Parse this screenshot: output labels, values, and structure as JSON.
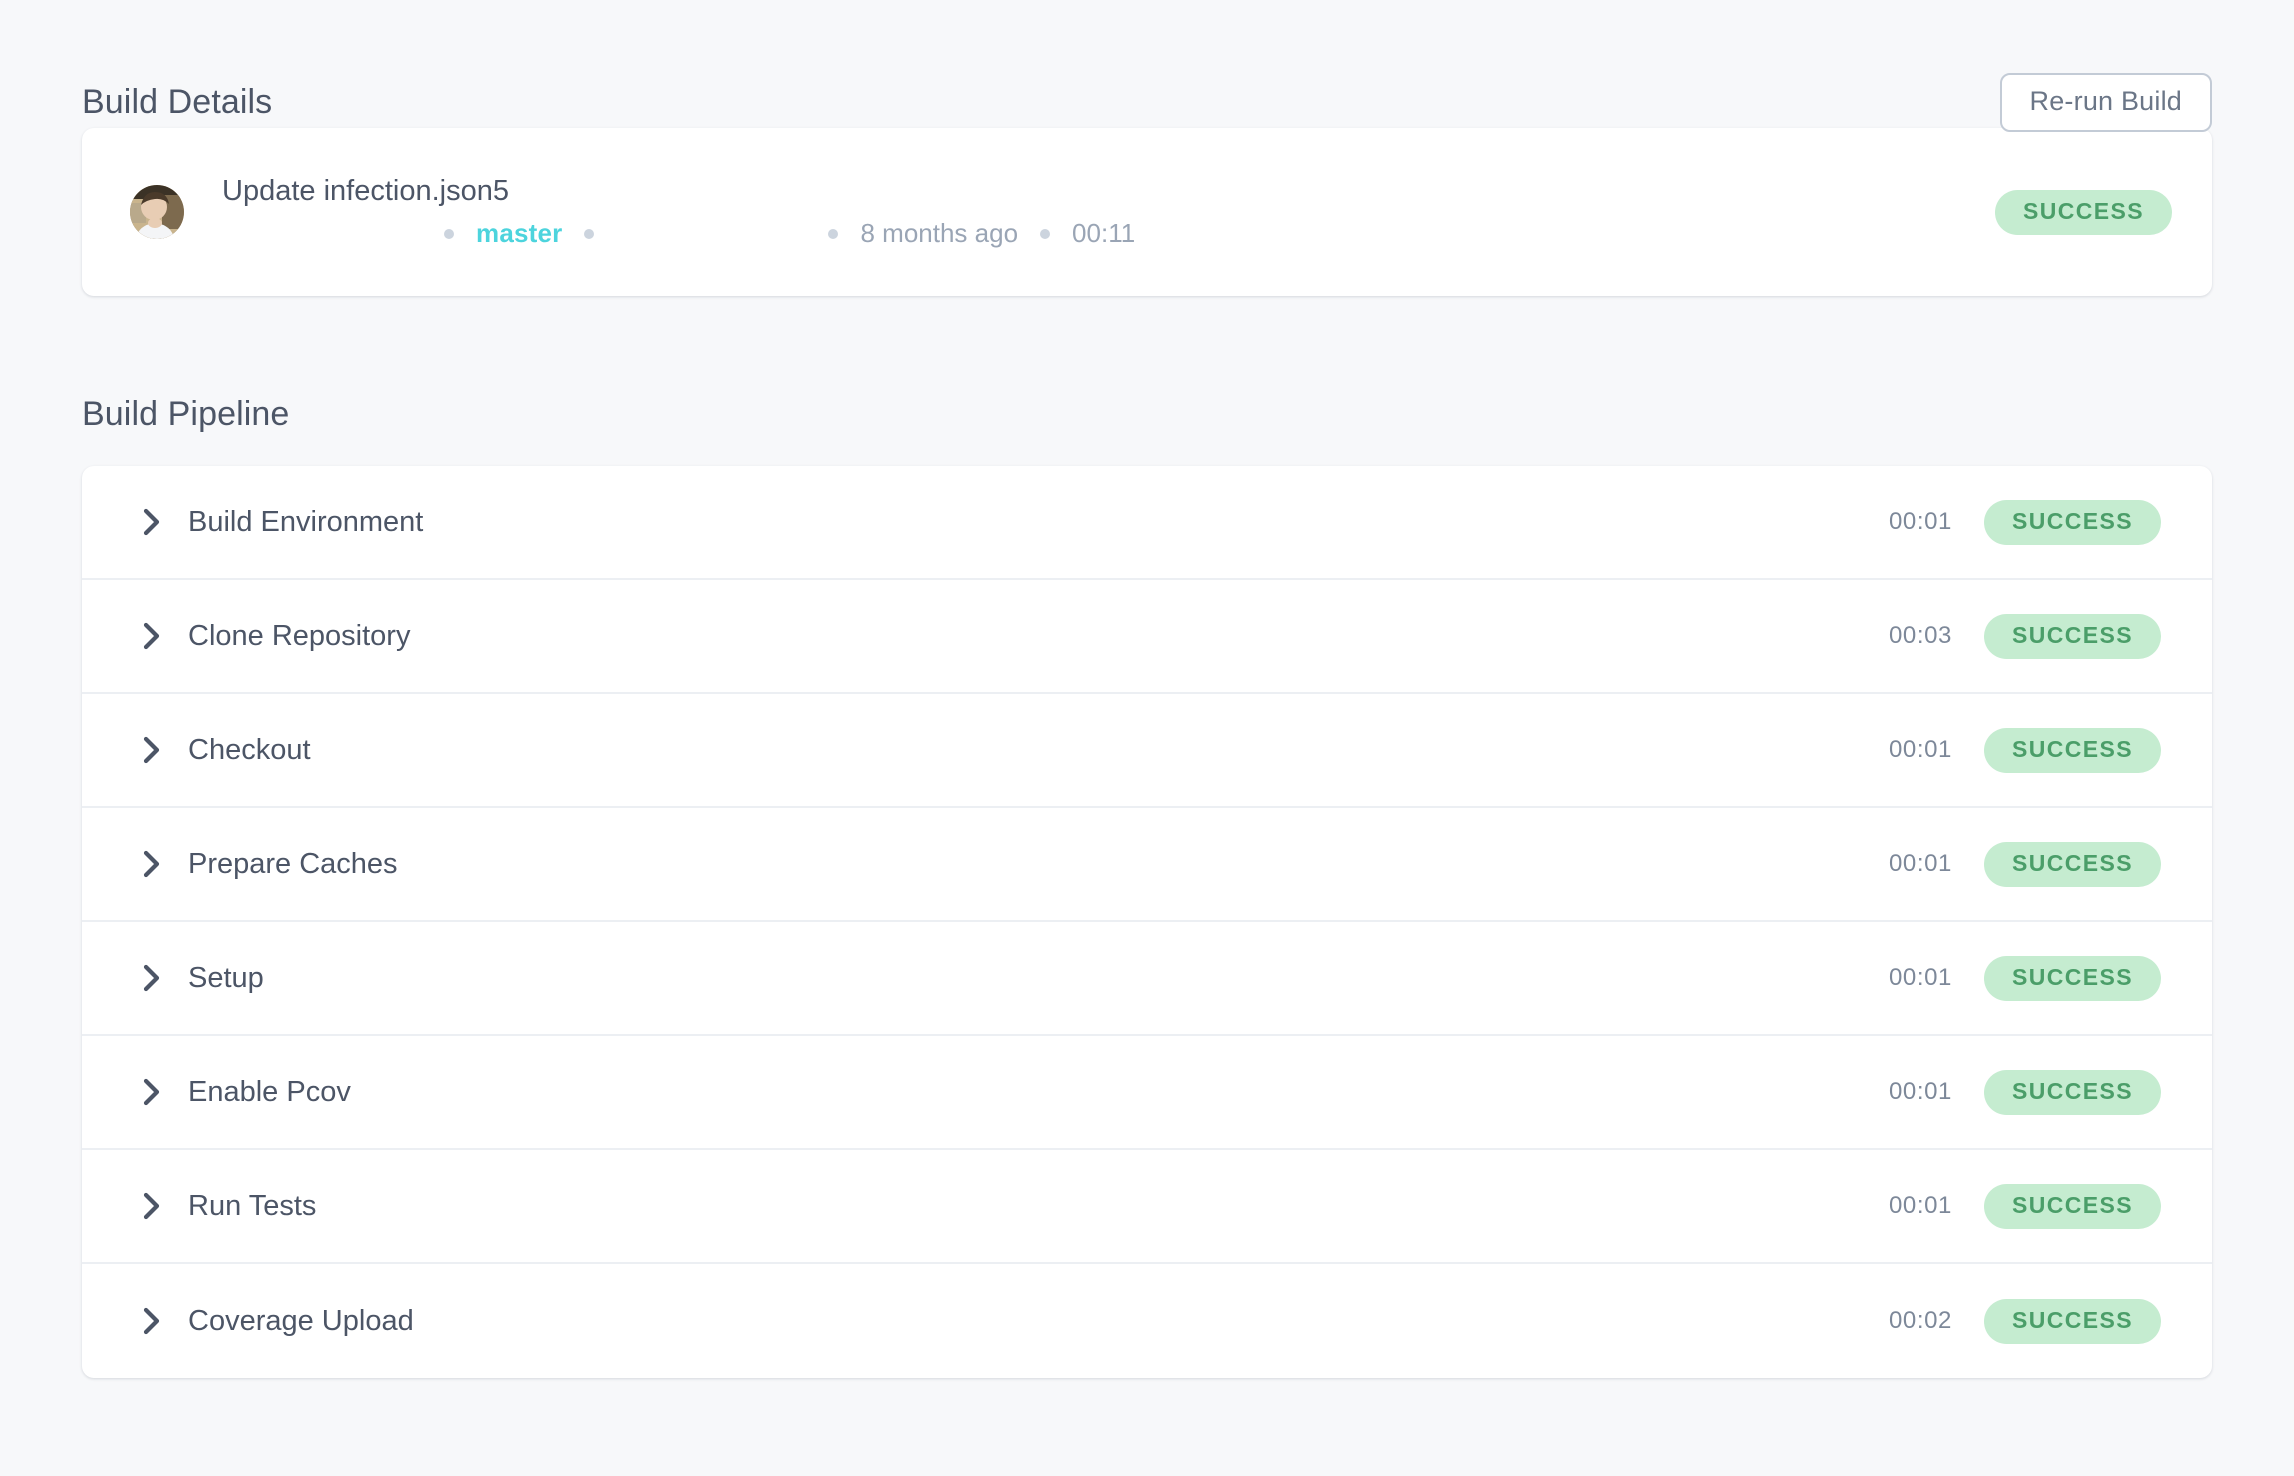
{
  "build_details": {
    "section_title": "Build Details",
    "rerun_label": "Re-run Build",
    "commit_message": "Update infection.json5",
    "author": "",
    "branch": "master",
    "commit_hash": "",
    "relative_time": "8 months ago",
    "duration": "00:11",
    "status": "SUCCESS",
    "avatar_name": "user-avatar"
  },
  "build_pipeline": {
    "section_title": "Build Pipeline",
    "stages": [
      {
        "name": "Build Environment",
        "duration": "00:01",
        "status": "SUCCESS"
      },
      {
        "name": "Clone Repository",
        "duration": "00:03",
        "status": "SUCCESS"
      },
      {
        "name": "Checkout",
        "duration": "00:01",
        "status": "SUCCESS"
      },
      {
        "name": "Prepare Caches",
        "duration": "00:01",
        "status": "SUCCESS"
      },
      {
        "name": "Setup",
        "duration": "00:01",
        "status": "SUCCESS"
      },
      {
        "name": "Enable Pcov",
        "duration": "00:01",
        "status": "SUCCESS"
      },
      {
        "name": "Run Tests",
        "duration": "00:01",
        "status": "SUCCESS"
      },
      {
        "name": "Coverage Upload",
        "duration": "00:02",
        "status": "SUCCESS"
      }
    ]
  },
  "icons": {
    "chevron_right": "chevron-right-icon"
  },
  "colors": {
    "page_background": "#f7f8fa",
    "card_background": "#ffffff",
    "text_primary": "#4c5566",
    "text_muted": "#9aa5b5",
    "branch_link": "#4dd4dd",
    "success_badge_bg": "#c5ecd0",
    "success_badge_text": "#4b9e69",
    "row_divider": "#eceff3",
    "button_border": "#c3cbd6"
  }
}
